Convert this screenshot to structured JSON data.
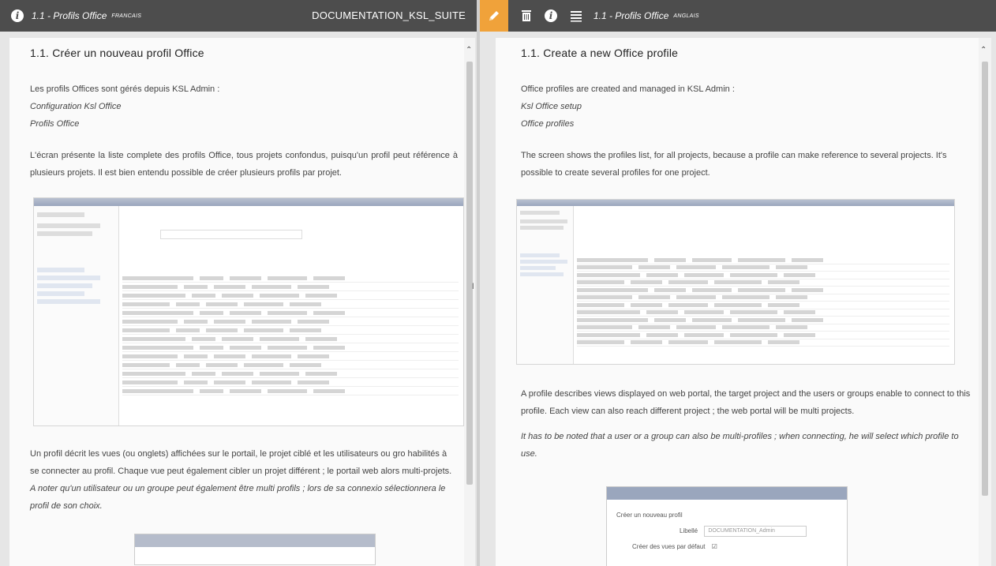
{
  "left": {
    "header": {
      "title": "1.1 - Profils Office",
      "lang": "FRANCAIS",
      "doc": "DOCUMENTATION_KSL_SUITE",
      "info_icon": "info-icon"
    },
    "heading": "1.1. Créer un nouveau profil Office",
    "p1": "Les profils Offices sont gérés depuis KSL Admin :",
    "nav1": "Configuration Ksl Office",
    "nav2": "Profils Office",
    "p2": "L'écran présente la liste complete des profils Office, tous projets confondus, puisqu'un profil peut référence à plusieurs projets. Il est bien entendu possible de créer plusieurs profils par projet.",
    "p3": "Un profil décrit les vues (ou onglets) affichées sur le portail, le projet ciblé et les utilisateurs ou gro habilités à se connecter au profil. Chaque vue peut également cibler un projet différent ; le portail web alors multi-projets.",
    "p4": "A noter qu'un utilisateur ou un groupe peut également être multi profils ; lors de sa connexio sélectionnera le profil de son choix."
  },
  "right": {
    "header": {
      "title": "1.1 - Profils Office",
      "lang": "ANGLAIS",
      "icons": [
        "pencil-icon",
        "trash-icon",
        "info-icon",
        "list-icon"
      ]
    },
    "heading": "1.1. Create a new Office profile",
    "p1": "Office profiles are created and managed in KSL Admin :",
    "nav1": "Ksl Office setup",
    "nav2": "Office profiles",
    "p2": "The screen shows the profiles list, for all projects, because a profile can make reference to several projects. It's possible to create several profiles for one project.",
    "p3": "A profile describes views displayed on web portal, the target project and the users or groups enable to connect to this profile. Each view can also reach different project ; the web portal will be multi projects.",
    "p4": "It has to be noted that a user or a group can also be multi-profiles ; when connecting, he will select which profile to use.",
    "dialog": {
      "title": "Créer un nouveau profil",
      "label": "Libellé",
      "value": "DOCUMENTATION_Admin",
      "checkbox_label": "Créer des vues par défaut"
    }
  }
}
